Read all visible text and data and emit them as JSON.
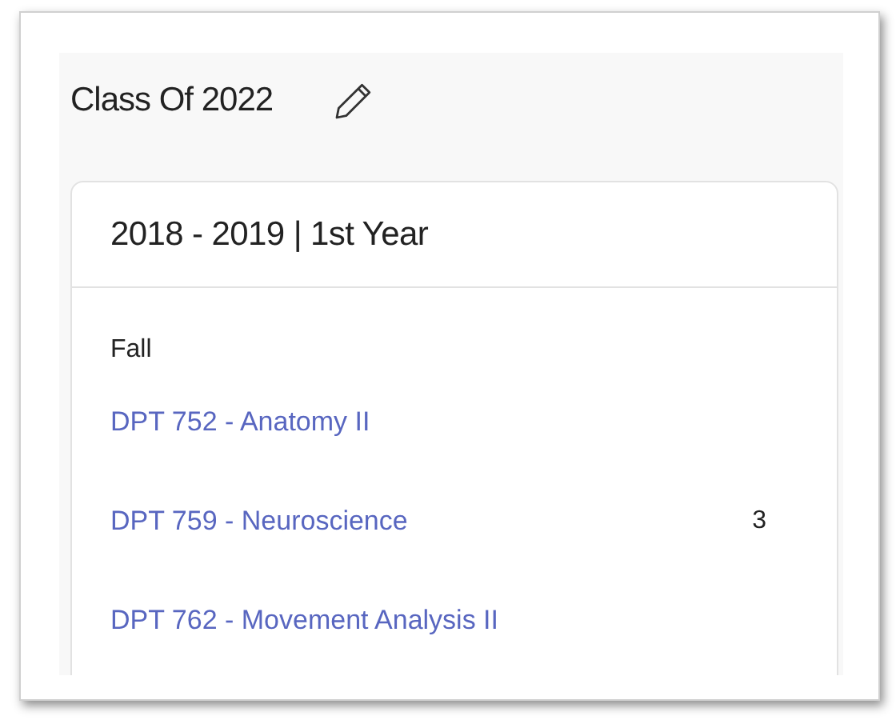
{
  "class_title": "Class Of 2022",
  "year_card": {
    "title": "2018 - 2019 | 1st Year",
    "terms": [
      {
        "name": "Fall",
        "courses": [
          {
            "label": "DPT 752 - Anatomy II"
          },
          {
            "label": "DPT 759 - Neuroscience",
            "credits": "3"
          },
          {
            "label": "DPT 762 - Movement Analysis II"
          }
        ]
      }
    ]
  }
}
